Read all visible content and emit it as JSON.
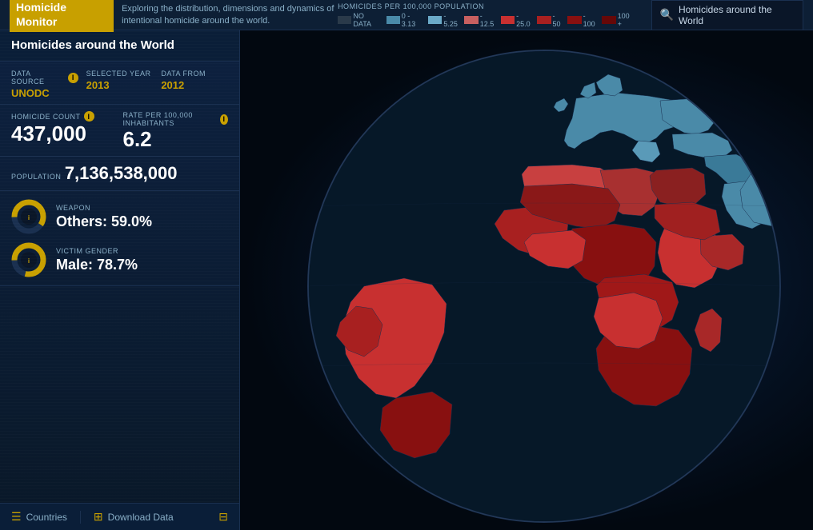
{
  "header": {
    "logo": "Homicide Monitor",
    "description": "Exploring the distribution, dimensions and dynamics of intentional homicide around the world.",
    "legend_label": "HOMICIDES PER 100,000 POPULATION",
    "legend_items": [
      {
        "label": "NO DATA",
        "color": "#2a3a4a"
      },
      {
        "label": "0 - 3.13",
        "color": "#4a8aa8"
      },
      {
        "label": "- 5.25",
        "color": "#6baac8"
      },
      {
        "label": "- 12.5",
        "color": "#c86060"
      },
      {
        "label": "- 25.0",
        "color": "#c83030"
      },
      {
        "label": "- 50",
        "color": "#a82020"
      },
      {
        "label": "- 100",
        "color": "#881010"
      },
      {
        "label": "100 +",
        "color": "#660808"
      }
    ],
    "search_placeholder": "Homicides around the World"
  },
  "sidebar": {
    "title": "Homicides around the World",
    "data_source_label": "DATA SOURCE",
    "data_source_value": "UNODC",
    "selected_year_label": "SELECTED YEAR",
    "selected_year_value": "2013",
    "data_from_label": "DATA FROM",
    "data_from_value": "2012",
    "homicide_count_label": "HOMICIDE COUNT",
    "homicide_count_value": "437,000",
    "rate_label": "RATE PER 100,000 INHABITANTS",
    "rate_value": "6.2",
    "population_label": "POPULATION",
    "population_value": "7,136,538,000",
    "weapon_label": "WEAPON",
    "weapon_value": "Others: 59.0%",
    "victim_gender_label": "VICTIM GENDER",
    "victim_gender_value": "Male: 78.7%",
    "countries_btn": "Countries",
    "download_btn": "Download Data"
  }
}
